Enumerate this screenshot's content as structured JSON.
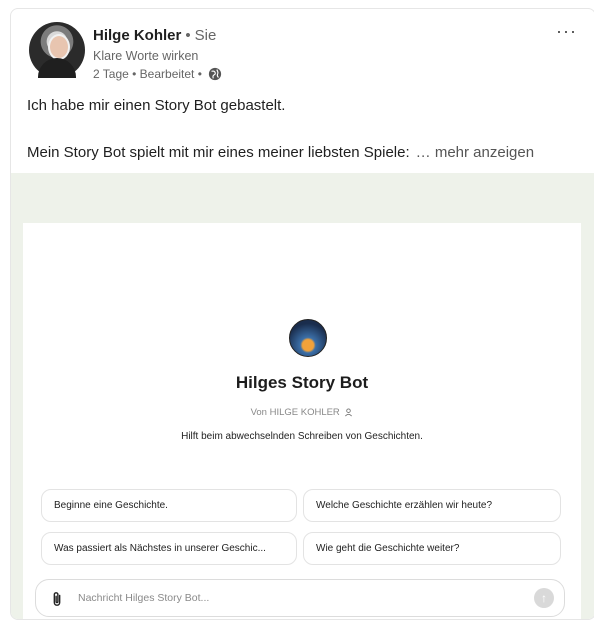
{
  "post": {
    "author_name": "Hilge Kohler",
    "author_relation": "Sie",
    "author_headline": "Klare Worte wirken",
    "meta": "2 Tage • Bearbeitet •",
    "more_menu": "···",
    "text_line1": "Ich habe mir einen Story Bot gebastelt.",
    "text_line2": "Mein Story Bot spielt mit mir eines meiner liebsten Spiele:",
    "see_more": "… mehr anzeigen"
  },
  "media": {
    "bot_title": "Hilges Story Bot",
    "bot_by": "Von HILGE KOHLER",
    "bot_description": "Hilft beim abwechselnden Schreiben von Geschichten.",
    "suggestions": [
      "Beginne eine Geschichte.",
      "Welche Geschichte erzählen wir heute?",
      "Was passiert als Nächstes in unserer Geschic...",
      "Wie geht die Geschichte weiter?"
    ],
    "composer_placeholder": "Nachricht Hilges Story Bot..."
  },
  "colors": {
    "media_background": "#eef2ea",
    "text_primary": "#1f1f1f",
    "text_secondary": "#666666"
  }
}
